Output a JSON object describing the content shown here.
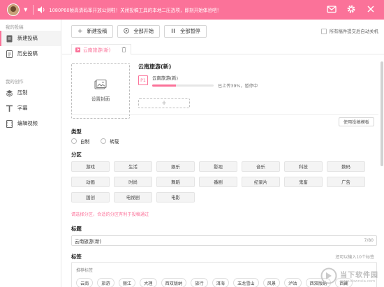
{
  "colors": {
    "accent": "#fb7299",
    "border": "#d6d6d6"
  },
  "header": {
    "notice": "1080P60帧高清码率开放公测啦！关闭投稿工具的本地二压选项，即刻开始体验吧！",
    "icons": [
      "avatar",
      "speaker-icon",
      "mail-icon",
      "settings-icon",
      "close-icon"
    ]
  },
  "sidebar": {
    "section1": "我的投稿",
    "items1": [
      {
        "label": "新建投稿",
        "icon": "upload-doc-icon",
        "active": true
      },
      {
        "label": "历史投稿",
        "icon": "history-doc-icon"
      }
    ],
    "section2": "我的创作",
    "items2": [
      {
        "label": "压制",
        "icon": "layers-icon"
      },
      {
        "label": "字幕",
        "icon": "subtitle-icon"
      },
      {
        "label": "编辑视频",
        "icon": "film-edit-icon"
      }
    ]
  },
  "toolbar": {
    "new_label": "新建投稿",
    "start_all_label": "全部开始",
    "pause_all_label": "全部暂停",
    "autoshutdown_label": "所有稿件提交后自动关机"
  },
  "tab": {
    "label": "云南旅游(新)"
  },
  "upload": {
    "cover_label": "设置封面",
    "video_title": "云南旅游(新)",
    "part_no": "P1",
    "part_name": "云南旅游(新)",
    "progress": 0.39,
    "status": "已上传39%，暂停中",
    "add_symbol": "+"
  },
  "template_button": "使用投稿模板",
  "type_section": {
    "title": "类型",
    "options": [
      "自制",
      "转载"
    ]
  },
  "category_section": {
    "title": "分区",
    "items": [
      "游戏",
      "生活",
      "娱乐",
      "影视",
      "音乐",
      "科技",
      "数码",
      "动画",
      "时尚",
      "舞蹈",
      "番剧",
      "纪录片",
      "鬼畜",
      "广告",
      "国创",
      "电视剧",
      "电影"
    ],
    "hint": "请选择分区，合适的分区有利于投稿通过"
  },
  "title_section": {
    "title": "标题",
    "value": "云南旅游(新)",
    "count": "7/80"
  },
  "tags_section": {
    "title": "标签",
    "hint": "还可以输入10个标签",
    "recommend_label": "推荐标签",
    "tags": [
      "云南",
      "旅游",
      "丽江",
      "大理",
      "西双版纳",
      "旅行",
      "洱海",
      "玉龙雪山",
      "风景",
      "泸沽",
      "西双版纳",
      "西藏"
    ]
  },
  "watermark": {
    "main": "当下软件园",
    "sub": "www.downxia.com"
  }
}
